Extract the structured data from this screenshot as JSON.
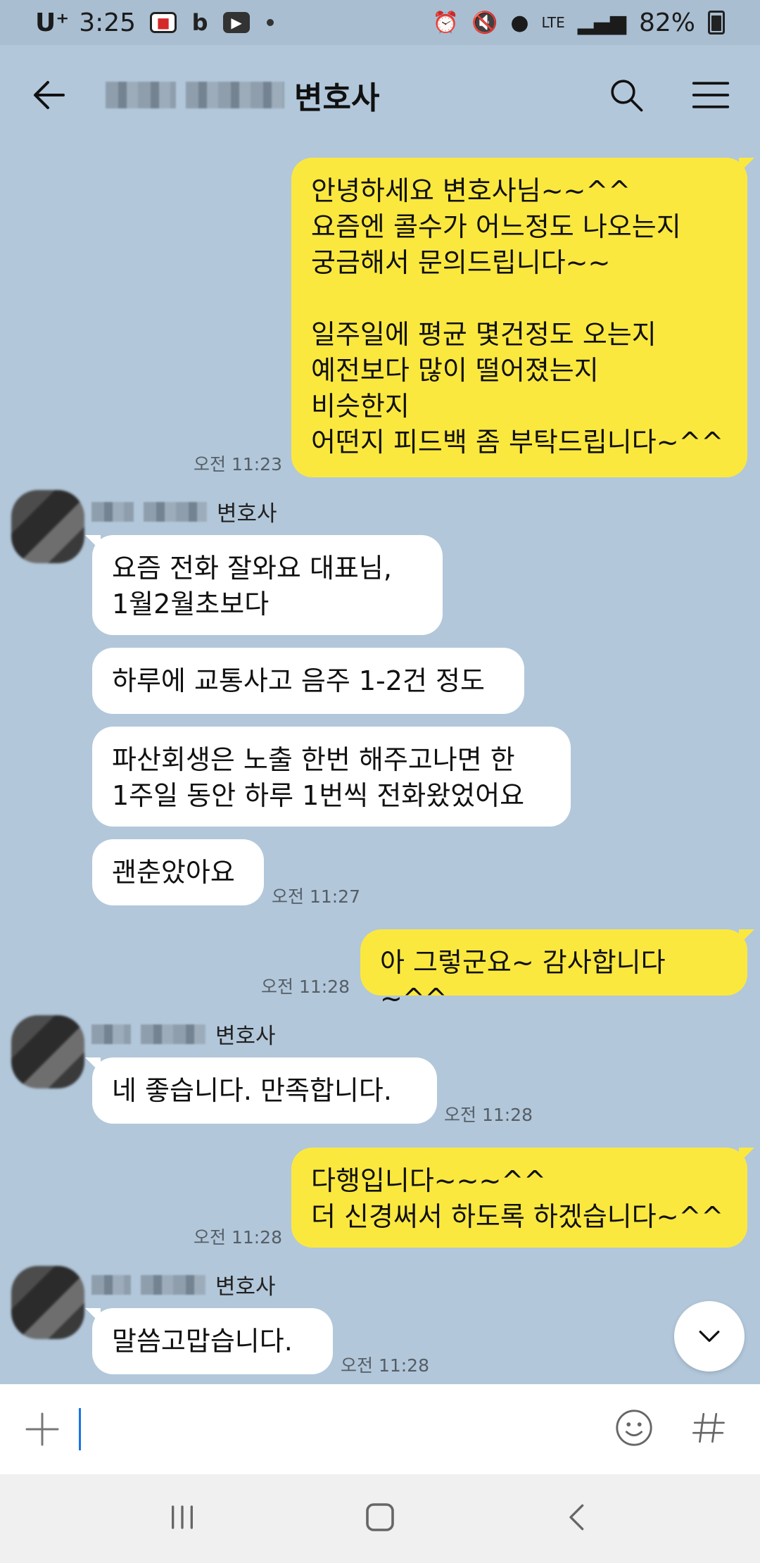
{
  "status_bar": {
    "carrier": "U⁺",
    "time": "3:25",
    "network": "LTE",
    "battery": "82%"
  },
  "header": {
    "title_suffix": "변호사"
  },
  "messages": [
    {
      "side": "me",
      "text": "안녕하세요 변호사님~~^^\n요즘엔 콜수가 어느정도 나오는지\n궁금해서 문의드립니다~~\n\n일주일에 평균 몇건정도 오는지\n예전보다 많이 떨어졌는지\n비슷한지\n어떤지 피드백 좀 부탁드립니다~^^",
      "time": "오전 11:23"
    },
    {
      "side": "them",
      "sender": "변호사",
      "text": "요즘 전화 잘와요 대표님,\n1월2월초보다"
    },
    {
      "side": "them",
      "text": "하루에 교통사고 음주 1-2건 정도"
    },
    {
      "side": "them",
      "text": "파산회생은 노출 한번 해주고나면 한\n1주일 동안 하루 1번씩 전화왔었어요"
    },
    {
      "side": "them",
      "text": "괜춘았아요",
      "time": "오전 11:27"
    },
    {
      "side": "me",
      "text": "아 그렇군요~ 감사합니다~^^",
      "time": "오전 11:28"
    },
    {
      "side": "them",
      "sender": "변호사",
      "text": "네 좋습니다. 만족합니다.",
      "time": "오전 11:28"
    },
    {
      "side": "me",
      "text": "다행입니다~~~^^\n더 신경써서 하도록 하겠습니다~^^",
      "time": "오전 11:28"
    },
    {
      "side": "them",
      "sender": "변호사",
      "text": "말씀고맙습니다.",
      "time": "오전 11:28"
    }
  ],
  "composer": {
    "placeholder": ""
  },
  "colors": {
    "chat_bg": "#b2c7da",
    "my_bubble": "#fbe83f",
    "their_bubble": "#ffffff"
  }
}
